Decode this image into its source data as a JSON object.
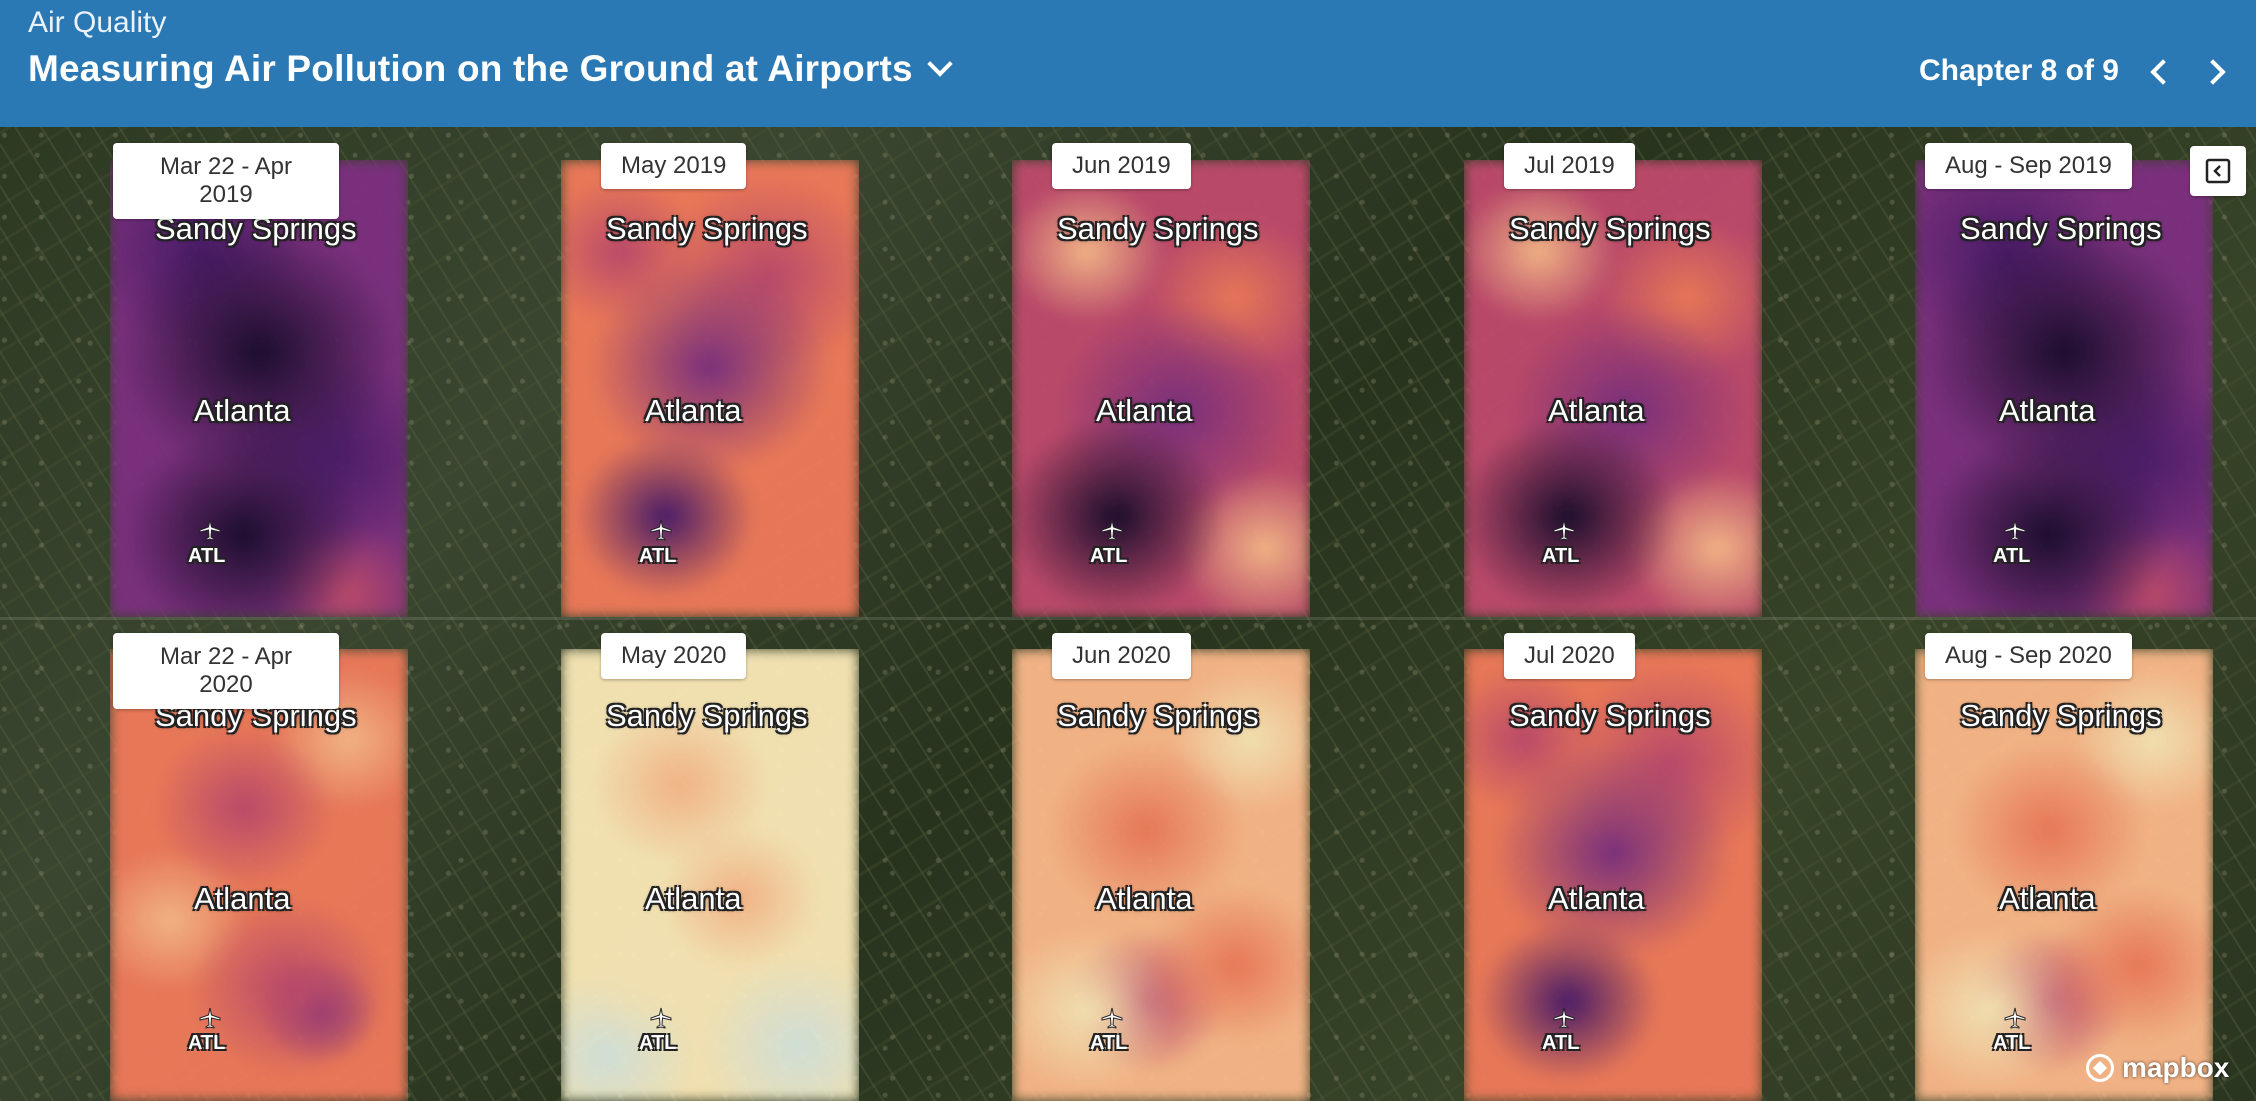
{
  "header": {
    "supertitle": "Air Quality",
    "title": "Measuring Air Pollution on the Ground at Airports",
    "chapter": "Chapter 8 of 9",
    "header_color": "#2a78b4"
  },
  "icons": {
    "title_menu": "chevron-down-icon",
    "prev": "chevron-left-icon",
    "next": "chevron-right-icon",
    "collapse": "collapse-panel-icon",
    "airport": "airplane-icon",
    "attribution": "mapbox-logo"
  },
  "panels": {
    "row2019": [
      {
        "label": "Mar 22 - Apr\n2019",
        "north": "Sandy Springs",
        "center": "Atlanta",
        "airport": "ATL",
        "intensity": "high"
      },
      {
        "label": "May 2019",
        "north": "Sandy Springs",
        "center": "Atlanta",
        "airport": "ATL",
        "intensity": "medium"
      },
      {
        "label": "Jun 2019",
        "north": "Sandy Springs",
        "center": "Atlanta",
        "airport": "ATL",
        "intensity": "medium-high"
      },
      {
        "label": "Jul 2019",
        "north": "Sandy Springs",
        "center": "Atlanta",
        "airport": "ATL",
        "intensity": "medium-high"
      },
      {
        "label": "Aug - Sep 2019",
        "north": "Sandy Springs",
        "center": "Atlanta",
        "airport": "ATL",
        "intensity": "high"
      }
    ],
    "row2020": [
      {
        "label": "Mar 22 - Apr\n2020",
        "north": "Sandy Springs",
        "center": "Atlanta",
        "airport": "ATL",
        "intensity": "medium-low"
      },
      {
        "label": "May 2020",
        "north": "Sandy Springs",
        "center": "Atlanta",
        "airport": "ATL",
        "intensity": "low"
      },
      {
        "label": "Jun 2020",
        "north": "Sandy Springs",
        "center": "Atlanta",
        "airport": "ATL",
        "intensity": "low-medium"
      },
      {
        "label": "Jul 2020",
        "north": "Sandy Springs",
        "center": "Atlanta",
        "airport": "ATL",
        "intensity": "medium"
      },
      {
        "label": "Aug - Sep 2020",
        "north": "Sandy Springs",
        "center": "Atlanta",
        "airport": "ATL",
        "intensity": "low-medium"
      }
    ]
  },
  "attribution": {
    "text": "mapbox"
  },
  "colors": {
    "very_high": "#1a0b2e",
    "high": "#4a1a6b",
    "medium_high": "#7d2f80",
    "medium": "#c04a6d",
    "medium_low": "#f07a5a",
    "low": "#fbb98a",
    "very_low": "#fbe9b8",
    "cleanest": "#d8e8e0"
  }
}
